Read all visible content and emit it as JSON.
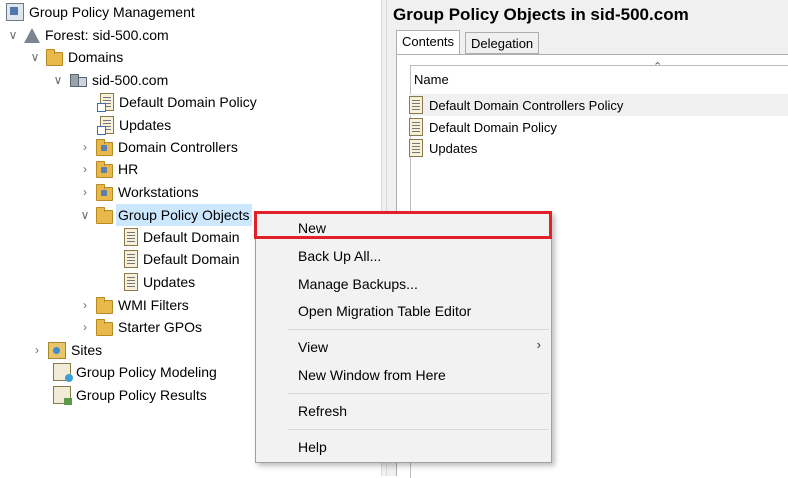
{
  "tree": {
    "root": "Group Policy Management",
    "forest": "Forest: sid-500.com",
    "domains": "Domains",
    "domain": "sid-500.com",
    "items": {
      "default_domain_policy": "Default Domain Policy",
      "updates": "Updates",
      "domain_controllers": "Domain Controllers",
      "hr": "HR",
      "workstations": "Workstations",
      "gpo_container": "Group Policy Objects",
      "gpo_child_1": "Default Domain",
      "gpo_child_2": "Default Domain",
      "gpo_child_3": "Updates",
      "wmi_filters": "WMI Filters",
      "starter_gpos": "Starter GPOs"
    },
    "sites": "Sites",
    "modeling": "Group Policy Modeling",
    "results": "Group Policy Results"
  },
  "right": {
    "title": "Group Policy Objects in sid-500.com",
    "tabs": [
      "Contents",
      "Delegation"
    ],
    "column_name": "Name",
    "gpos": [
      "Default Domain Controllers Policy",
      "Default Domain Policy",
      "Updates"
    ]
  },
  "context_menu": {
    "new": "New",
    "back_up_all": "Back Up All...",
    "manage_backups": "Manage Backups...",
    "open_migration": "Open Migration Table Editor",
    "view": "View",
    "new_window": "New Window from Here",
    "refresh": "Refresh",
    "help": "Help"
  },
  "colors": {
    "highlight_border": "#e2202a",
    "selection": "#cce8ff"
  }
}
